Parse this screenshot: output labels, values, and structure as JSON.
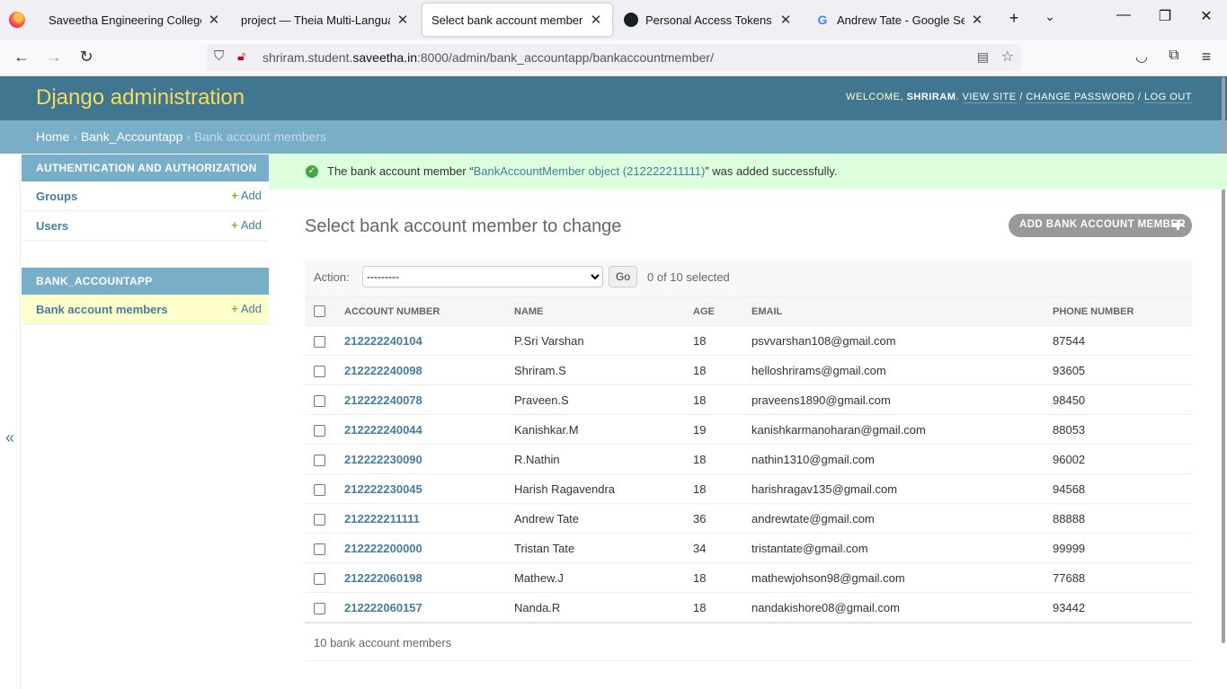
{
  "browser": {
    "tabs": [
      {
        "label": "Saveetha Engineering College",
        "active": false
      },
      {
        "label": "project — Theia Multi-Language IDE",
        "active": false
      },
      {
        "label": "Select bank account member to change",
        "active": true
      },
      {
        "label": "Personal Access Tokens (Classic)",
        "active": false
      },
      {
        "label": "Andrew Tate - Google Search",
        "active": false
      }
    ],
    "url": {
      "prefix": "shriram.student.",
      "domain": "saveetha.in",
      "suffix": ":8000/admin/bank_accountapp/bankaccountmember/"
    }
  },
  "header": {
    "branding": "Django administration",
    "welcome": "Welcome,",
    "username": "shriram",
    "view_site": "View site",
    "change_password": "Change password",
    "log_out": "Log out"
  },
  "breadcrumbs": {
    "home": "Home",
    "app": "Bank_Accountapp",
    "current": "Bank account members"
  },
  "sidebar": {
    "modules": [
      {
        "caption": "Authentication and Authorization",
        "items": [
          {
            "label": "Groups",
            "add": "Add"
          },
          {
            "label": "Users",
            "add": "Add"
          }
        ]
      },
      {
        "caption": "Bank_Accountapp",
        "items": [
          {
            "label": "Bank account members",
            "add": "Add"
          }
        ]
      }
    ],
    "toggle": "«"
  },
  "message": {
    "before": "The bank account member “",
    "link": "BankAccountMember object (212222211111)",
    "after": "” was added successfully."
  },
  "content": {
    "title": "Select bank account member to change",
    "add_button": "Add bank account member",
    "action_label": "Action:",
    "action_selected": "---------",
    "go": "Go",
    "counter": "0 of 10 selected",
    "columns": [
      "Account number",
      "Name",
      "Age",
      "Email",
      "Phone number"
    ],
    "rows": [
      [
        "212222240104",
        "P.Sri Varshan",
        "18",
        "psvvarshan108@gmail.com",
        "87544"
      ],
      [
        "212222240098",
        "Shriram.S",
        "18",
        "helloshrirams@gmail.com",
        "93605"
      ],
      [
        "212222240078",
        "Praveen.S",
        "18",
        "praveens1890@gmail.com",
        "98450"
      ],
      [
        "212222240044",
        "Kanishkar.M",
        "19",
        "kanishkarmanoharan@gmail.com",
        "88053"
      ],
      [
        "212222230090",
        "R.Nathin",
        "18",
        "nathin1310@gmail.com",
        "96002"
      ],
      [
        "212222230045",
        "Harish Ragavendra",
        "18",
        "harishragav135@gmail.com",
        "94568"
      ],
      [
        "212222211111",
        "Andrew Tate",
        "36",
        "andrewtate@gmail.com",
        "88888"
      ],
      [
        "212222200000",
        "Tristan Tate",
        "34",
        "tristantate@gmail.com",
        "99999"
      ],
      [
        "212222060198",
        "Mathew.J",
        "18",
        "mathewjohson98@gmail.com",
        "77688"
      ],
      [
        "212222060157",
        "Nanda.R",
        "18",
        "nandakishore08@gmail.com",
        "93442"
      ]
    ],
    "paginator": "10 bank account members"
  }
}
